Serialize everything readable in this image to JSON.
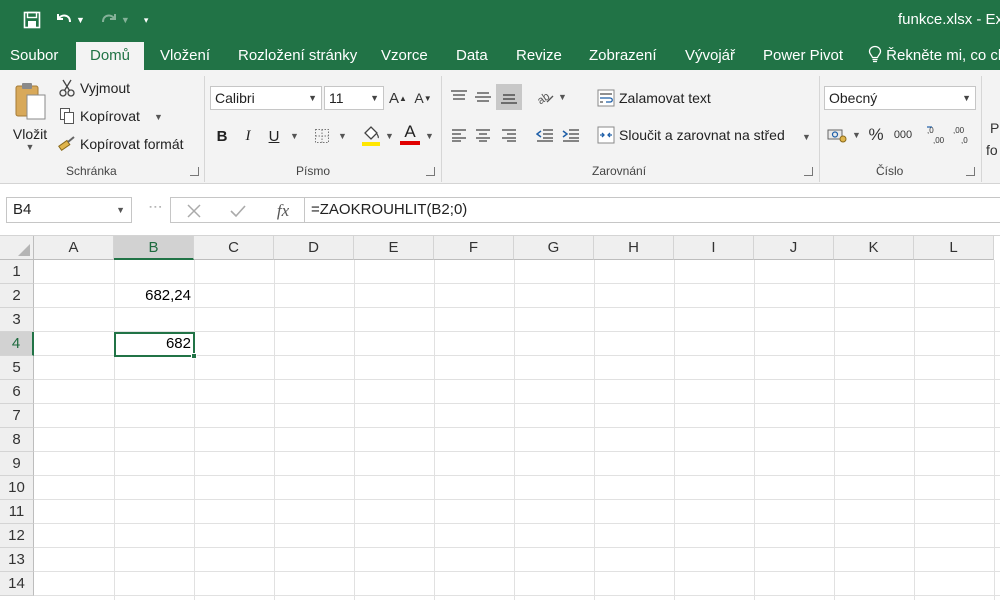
{
  "window": {
    "title": "funkce.xlsx - Ex"
  },
  "tabs": [
    "Soubor",
    "Domů",
    "Vložení",
    "Rozložení stránky",
    "Vzorce",
    "Data",
    "Revize",
    "Zobrazení",
    "Vývojář",
    "Power Pivot"
  ],
  "tell_me": "Řekněte mi, co ch",
  "ribbon": {
    "clipboard": {
      "paste": "Vložit",
      "cut": "Vyjmout",
      "copy": "Kopírovat",
      "format_painter": "Kopírovat formát",
      "label": "Schránka"
    },
    "font": {
      "name": "Calibri",
      "size": "11",
      "bold": "B",
      "italic": "I",
      "underline": "U",
      "font_color": "A",
      "label": "Písmo"
    },
    "alignment": {
      "wrap": "Zalamovat text",
      "merge": "Sloučit a zarovnat na střed",
      "label": "Zarovnání"
    },
    "number": {
      "format": "Obecný",
      "percent": "%",
      "thousands": "000",
      "label": "Číslo"
    },
    "styles_partial": [
      "P",
      "fo"
    ]
  },
  "formula_bar": {
    "name_box": "B4",
    "fx": "fx",
    "formula": "=ZAOKROUHLIT(B2;0)"
  },
  "grid": {
    "columns": [
      "A",
      "B",
      "C",
      "D",
      "E",
      "F",
      "G",
      "H",
      "I",
      "J",
      "K",
      "L"
    ],
    "rows": [
      "1",
      "2",
      "3",
      "4",
      "5",
      "6",
      "7",
      "8",
      "9",
      "10",
      "11",
      "12",
      "13",
      "14"
    ],
    "selected_column": "B",
    "selected_row": "4",
    "cells": {
      "B2": "682,24",
      "B4": "682"
    }
  },
  "colors": {
    "accent": "#217346",
    "font_color_bar": "#e00000",
    "highlight_bar": "#ffe600"
  }
}
